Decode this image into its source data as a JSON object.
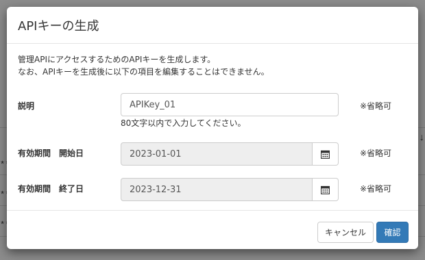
{
  "background": {
    "fragments": [
      "**",
      "**",
      "**",
      "↓"
    ]
  },
  "dialog": {
    "title": "APIキーの生成",
    "description_line1": "管理APIにアクセスするためのAPIキーを生成します。",
    "description_line2": "なお、APIキーを生成後に以下の項目を編集することはできません。",
    "description_field": {
      "label": "説明",
      "value": "APIKey_01",
      "hint": "80文字以内で入力してください。",
      "optional": "※省略可"
    },
    "start_date": {
      "label": "有効期間　開始日",
      "value": "2023-01-01",
      "optional": "※省略可"
    },
    "end_date": {
      "label": "有効期間　終了日",
      "value": "2023-12-31",
      "optional": "※省略可"
    },
    "footer": {
      "cancel_label": "キャンセル",
      "confirm_label": "確認"
    }
  }
}
